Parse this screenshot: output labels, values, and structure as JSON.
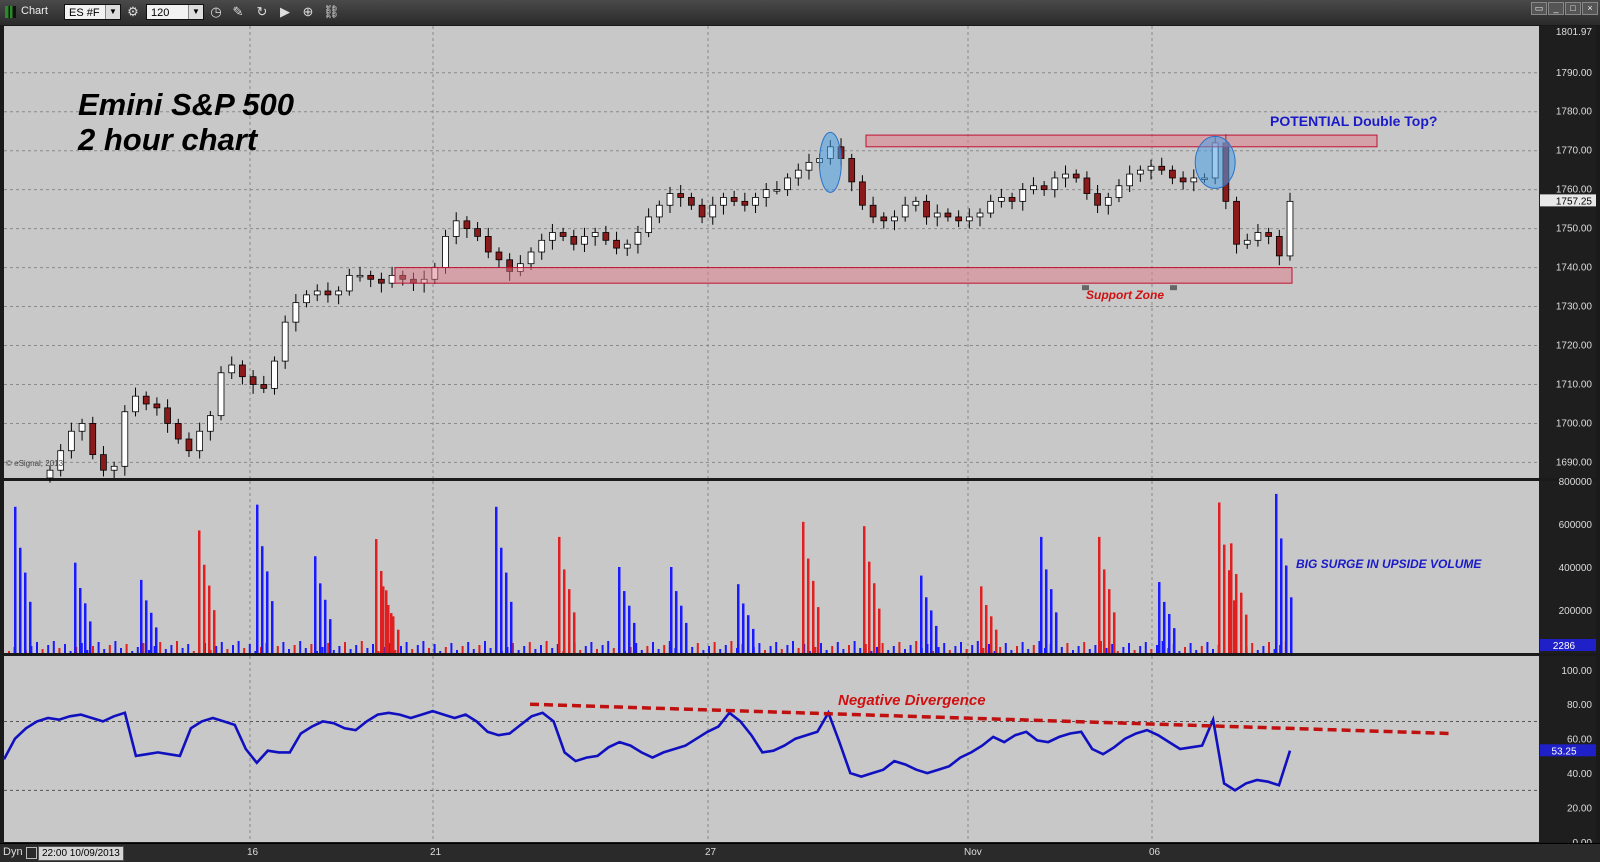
{
  "app": {
    "title": "Chart"
  },
  "toolbar": {
    "symbol": "ES #F",
    "interval": "120"
  },
  "status": {
    "mode": "Dyn",
    "date_time": "22:00 10/09/2013"
  },
  "x_ticks": [
    "16",
    "21",
    "27",
    "Nov",
    "06"
  ],
  "annotations": {
    "title_line1": "Emini S&P 500",
    "title_line2": "2 hour chart",
    "double_top": "POTENTIAL Double Top?",
    "support": "Support Zone",
    "volume_note": "BIG SURGE IN UPSIDE VOLUME",
    "divergence": "Negative Divergence",
    "copyright": "© eSignal, 2013"
  },
  "colors": {
    "up_candle": "#ffffff",
    "down_candle": "#8b1a1a",
    "up_volume": "#1a1aff",
    "down_volume": "#e02020",
    "indicator": "#1010c0",
    "zone_fill": "#e07a8a",
    "zone_stroke": "#c01030",
    "highlight": "#4aa0e8"
  },
  "chart_data": [
    {
      "type": "candlestick",
      "title": "Emini S&P 500 2 hour chart",
      "ylim": [
        1686,
        1802
      ],
      "y_ticks": [
        1690,
        1700,
        1710,
        1720,
        1730,
        1740,
        1750,
        1760,
        1770,
        1780,
        1790
      ],
      "top_label": "1801.97",
      "last_price": "1757.25",
      "closes": [
        1688,
        1693,
        1698,
        1700,
        1692,
        1688,
        1689,
        1703,
        1707,
        1705,
        1704,
        1700,
        1696,
        1693,
        1698,
        1702,
        1713,
        1715,
        1712,
        1710,
        1709,
        1716,
        1726,
        1731,
        1733,
        1734,
        1733,
        1734,
        1738,
        1738,
        1737,
        1736,
        1738,
        1737,
        1736,
        1737,
        1740,
        1748,
        1752,
        1750,
        1748,
        1744,
        1742,
        1739,
        1741,
        1744,
        1747,
        1749,
        1748,
        1746,
        1748,
        1749,
        1747,
        1745,
        1746,
        1749,
        1753,
        1756,
        1759,
        1758,
        1756,
        1753,
        1756,
        1758,
        1757,
        1756,
        1758,
        1760,
        1760,
        1763,
        1765,
        1767,
        1768,
        1771,
        1768,
        1762,
        1756,
        1753,
        1752,
        1753,
        1756,
        1757,
        1753,
        1754,
        1753,
        1752,
        1753,
        1754,
        1757,
        1758,
        1757,
        1760,
        1761,
        1760,
        1763,
        1764,
        1763,
        1759,
        1756,
        1758,
        1761,
        1764,
        1765,
        1766,
        1765,
        1763,
        1762,
        1763,
        1763,
        1772,
        1757,
        1746,
        1747,
        1749,
        1748,
        1743,
        1757
      ],
      "shading": [
        {
          "label": "Support Zone",
          "from": 1736,
          "to": 1740
        },
        {
          "label": "POTENTIAL Double Top?",
          "from": 1771,
          "to": 1774
        }
      ]
    },
    {
      "type": "bar",
      "title": "Volume",
      "ylim": [
        0,
        800000
      ],
      "y_ticks": [
        200000,
        400000,
        600000,
        800000
      ],
      "last_label": "2286",
      "volume_spikes": [
        {
          "series": "up",
          "value": 680000
        },
        {
          "series": "up",
          "value": 420000
        },
        {
          "series": "up",
          "value": 340000
        },
        {
          "series": "down",
          "value": 570000
        },
        {
          "series": "up",
          "value": 690000
        },
        {
          "series": "up",
          "value": 450000
        },
        {
          "series": "down",
          "value": 530000
        },
        {
          "series": "down",
          "value": 310000
        },
        {
          "series": "up",
          "value": 680000
        },
        {
          "series": "down",
          "value": 540000
        },
        {
          "series": "up",
          "value": 400000
        },
        {
          "series": "up",
          "value": 400000
        },
        {
          "series": "up",
          "value": 320000
        },
        {
          "series": "down",
          "value": 610000
        },
        {
          "series": "down",
          "value": 590000
        },
        {
          "series": "up",
          "value": 360000
        },
        {
          "series": "down",
          "value": 310000
        },
        {
          "series": "up",
          "value": 540000
        },
        {
          "series": "down",
          "value": 540000
        },
        {
          "series": "up",
          "value": 330000
        },
        {
          "series": "down",
          "value": 700000
        },
        {
          "series": "down",
          "value": 510000
        },
        {
          "series": "up",
          "value": 740000
        }
      ]
    },
    {
      "type": "line",
      "title": "Oscillator",
      "ylim": [
        0,
        108
      ],
      "y_ticks": [
        0,
        20,
        40,
        60,
        80,
        100
      ],
      "last_label": "53.25",
      "reference_lines": [
        70,
        30
      ],
      "values": [
        48,
        60,
        66,
        70,
        72,
        71,
        73,
        74,
        72,
        70,
        73,
        75,
        50,
        51,
        52,
        51,
        50,
        66,
        70,
        72,
        70,
        68,
        54,
        46,
        53,
        52,
        52,
        63,
        67,
        70,
        69,
        66,
        65,
        70,
        74,
        75,
        74,
        72,
        74,
        76,
        74,
        72,
        74,
        70,
        64,
        62,
        63,
        68,
        73,
        75,
        70,
        52,
        47,
        49,
        50,
        55,
        58,
        56,
        52,
        49,
        52,
        54,
        56,
        60,
        64,
        67,
        75,
        70,
        62,
        52,
        53,
        56,
        60,
        62,
        64,
        75,
        58,
        40,
        38,
        40,
        42,
        47,
        45,
        42,
        40,
        42,
        44,
        49,
        52,
        56,
        61,
        58,
        62,
        64,
        59,
        58,
        61,
        63,
        64,
        54,
        51,
        55,
        60,
        63,
        65,
        62,
        58,
        54,
        55,
        56,
        71,
        34,
        30,
        34,
        36,
        35,
        33,
        53
      ],
      "trendline": {
        "label": "Negative Divergence",
        "from": 80,
        "to": 63
      }
    }
  ]
}
